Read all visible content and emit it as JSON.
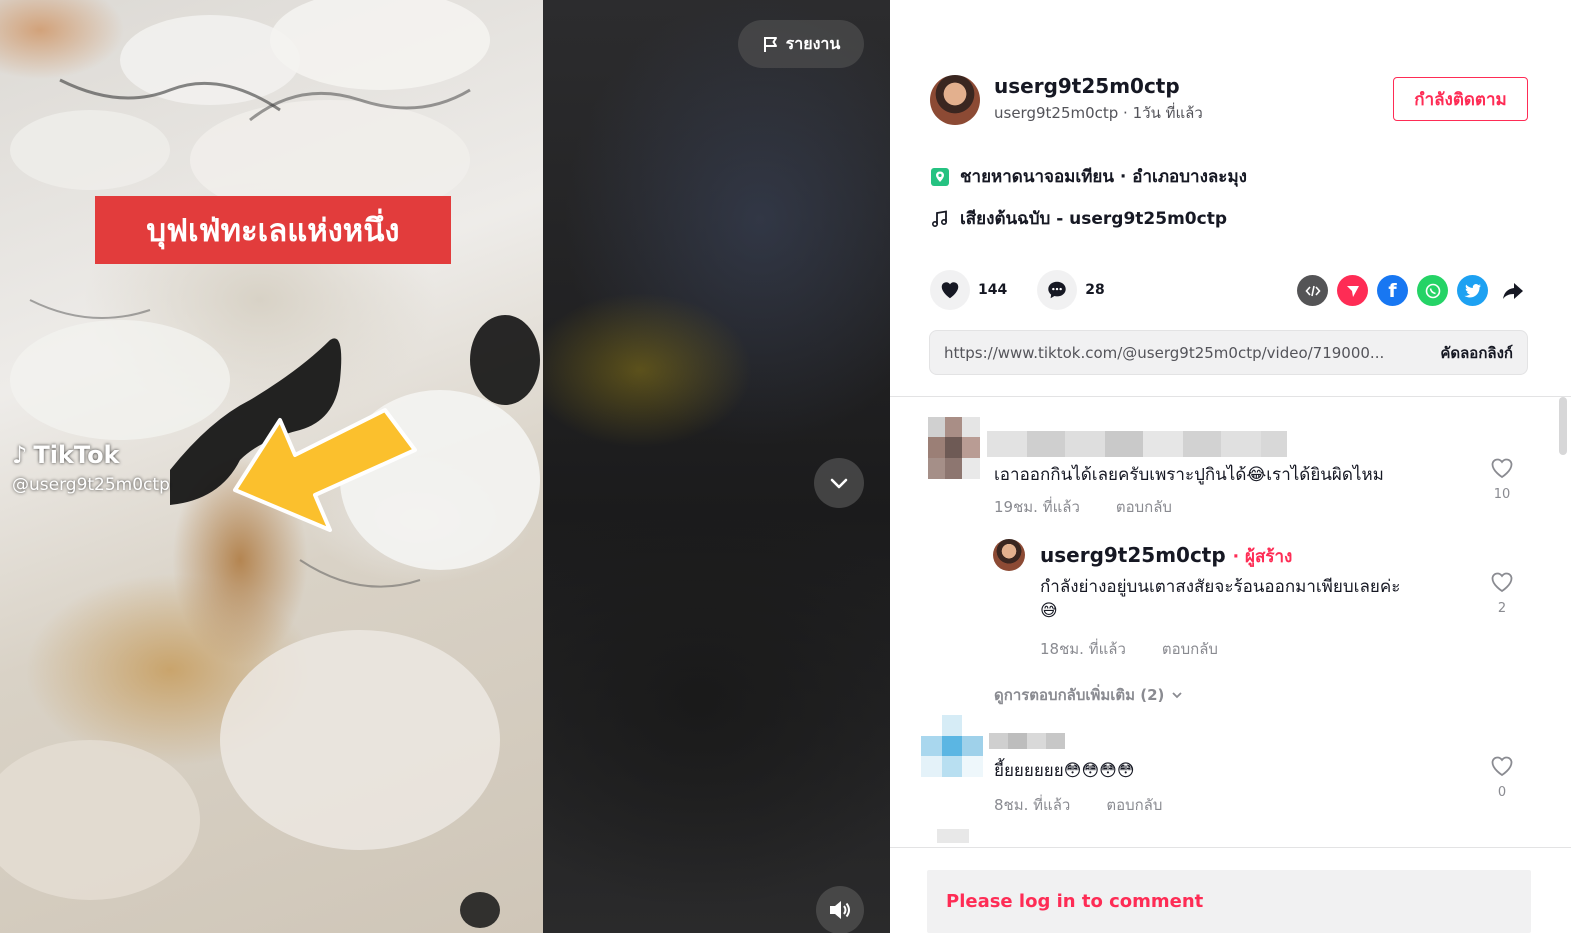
{
  "video": {
    "caption_banner": "บุฟเฟ่ทะเลแห่งหนึ่ง",
    "watermark_brand": "TikTok",
    "watermark_handle": "@userg9t25m0ctp",
    "report_label": "รายงาน"
  },
  "author": {
    "username": "userg9t25m0ctp",
    "subline": "userg9t25m0ctp · 1วัน ที่แล้ว",
    "follow_label": "กำลังติดตาม"
  },
  "meta": {
    "location": "ชายหาดนาจอมเทียน · อำเภอบางละมุง",
    "sound": "เสียงต้นฉบับ - userg9t25m0ctp"
  },
  "actions": {
    "likes": "144",
    "comments": "28"
  },
  "share": {
    "icons": [
      "embed-icon",
      "send-icon",
      "facebook-icon",
      "whatsapp-icon",
      "twitter-icon",
      "share-arrow-icon"
    ]
  },
  "link": {
    "url": "https://www.tiktok.com/@userg9t25m0ctp/video/719000...",
    "copy_label": "คัดลอกลิงก์"
  },
  "comments": [
    {
      "text": "เอาออกกินได้เลยครับเพราะปูกินได้😂เราได้ยินผิดไหม",
      "time": "19ชม. ที่แล้ว",
      "reply_label": "ตอบกลับ",
      "likes": "10"
    },
    {
      "text": "ยี้ยยยยยย😳😳😳😳",
      "time": "8ชม. ที่แล้ว",
      "reply_label": "ตอบกลับ",
      "likes": "0"
    }
  ],
  "reply": {
    "username": "userg9t25m0ctp",
    "creator_tag": "· ผู้สร้าง",
    "text_line1": "กำลังย่างอยู่บนเตาสงสัยจะร้อนออกมาเพียบเลยค่ะ",
    "text_line2": "😅",
    "time": "18ชม. ที่แล้ว",
    "reply_label": "ตอบกลับ",
    "likes": "2"
  },
  "more_replies": "ดูการตอบกลับเพิ่มเติม (2)",
  "login_prompt": "Please log in to comment",
  "colors": {
    "accent": "#fe2c55",
    "banner_red": "#e23c3c",
    "arrow_yellow": "#fbc02d",
    "location_green": "#25c281"
  }
}
